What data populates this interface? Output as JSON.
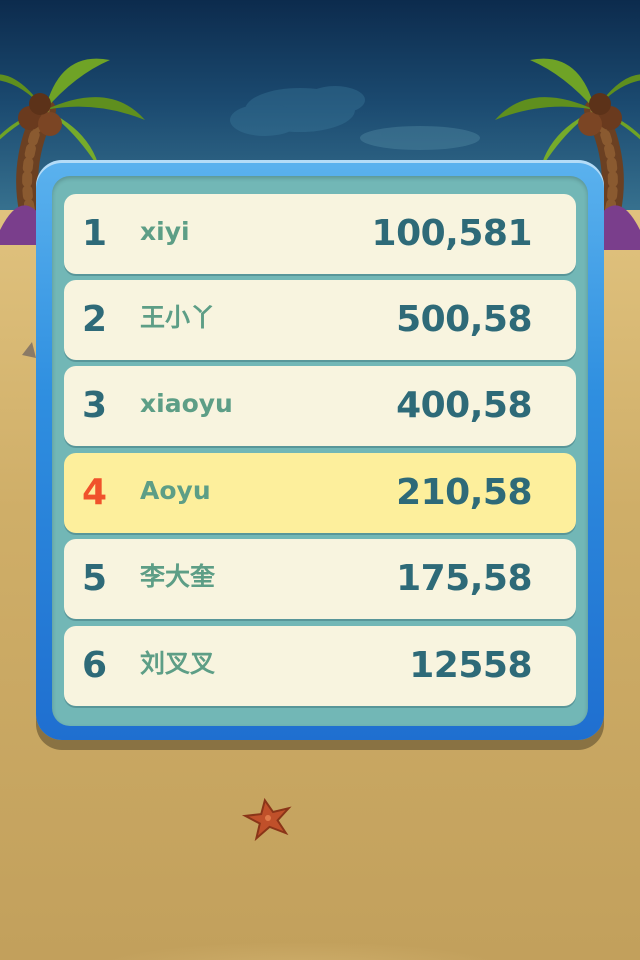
{
  "leaderboard": {
    "entries": [
      {
        "rank": "1",
        "name": "xiyi",
        "score": "100,581",
        "highlighted": false
      },
      {
        "rank": "2",
        "name": "王小丫",
        "score": "500,58",
        "highlighted": false
      },
      {
        "rank": "3",
        "name": "xiaoyu",
        "score": "400,58",
        "highlighted": false
      },
      {
        "rank": "4",
        "name": "Aoyu",
        "score": "210,58",
        "highlighted": true
      },
      {
        "rank": "5",
        "name": "李大奎",
        "score": "175,58",
        "highlighted": false
      },
      {
        "rank": "6",
        "name": "刘叉叉",
        "score": "12558",
        "highlighted": false
      }
    ]
  },
  "colors": {
    "panel_frame": "#2f8fe0",
    "panel_inner": "#72b7b6",
    "row_background": "#f8f4df",
    "row_highlight": "#fdef9c",
    "rank_text": "#2e6a78",
    "rank_highlight_text": "#f0522b",
    "name_text": "#5d9e86",
    "score_text": "#2e6a78"
  },
  "icons": {
    "left_tree": "palm-tree-icon",
    "right_tree": "palm-tree-icon",
    "starfish": "starfish-icon",
    "cloud": "cloud-icon"
  }
}
